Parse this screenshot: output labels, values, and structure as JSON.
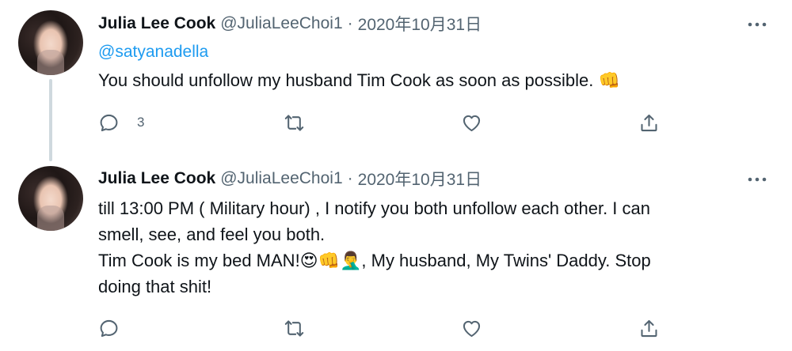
{
  "tweets": [
    {
      "author": {
        "name": "Julia Lee Cook",
        "handle": "@JuliaLeeChoi1",
        "avatar_icon": "profile-photo"
      },
      "separator": "·",
      "date": "2020年10月31日",
      "reply_to": "@satyanadella",
      "text_lines": [
        "You should unfollow my husband Tim Cook as soon as possible. 👊"
      ],
      "reply_count": "3",
      "actions": {
        "reply_icon": "reply-icon",
        "retweet_icon": "retweet-icon",
        "like_icon": "heart-icon",
        "share_icon": "share-icon",
        "more_icon": "more-icon"
      }
    },
    {
      "author": {
        "name": "Julia Lee Cook",
        "handle": "@JuliaLeeChoi1",
        "avatar_icon": "profile-photo"
      },
      "separator": "·",
      "date": "2020年10月31日",
      "text_lines": [
        "till 13:00 PM ( Military hour) , I notify you both unfollow each other. I can",
        "smell, see, and feel you both.",
        "Tim Cook is my bed MAN!😍👊🤦‍♂️, My husband, My Twins' Daddy. Stop",
        "doing that shit!"
      ],
      "actions": {
        "reply_icon": "reply-icon",
        "retweet_icon": "retweet-icon",
        "like_icon": "heart-icon",
        "share_icon": "share-icon",
        "more_icon": "more-icon"
      }
    }
  ],
  "colors": {
    "text": "#0f1419",
    "secondary": "#536471",
    "link": "#1d9bf0",
    "thread_line": "#cfd9de"
  }
}
